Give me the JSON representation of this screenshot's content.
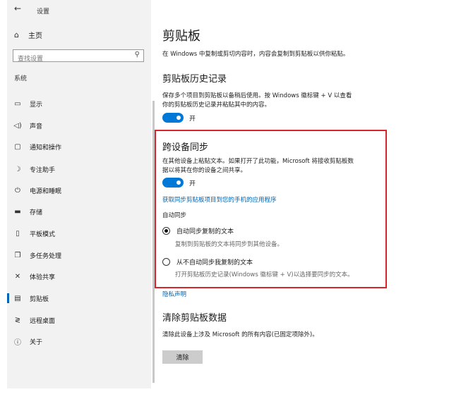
{
  "window": {
    "title": "设置",
    "back_icon": "back-arrow-icon"
  },
  "sidebar": {
    "home_label": "主页",
    "search_placeholder": "查找设置",
    "section_label": "系统",
    "items": [
      {
        "label": "显示",
        "icon": "display-icon"
      },
      {
        "label": "声音",
        "icon": "sound-icon"
      },
      {
        "label": "通知和操作",
        "icon": "notification-icon"
      },
      {
        "label": "专注助手",
        "icon": "focus-assist-icon"
      },
      {
        "label": "电源和睡眠",
        "icon": "power-icon"
      },
      {
        "label": "存储",
        "icon": "storage-icon"
      },
      {
        "label": "平板模式",
        "icon": "tablet-icon"
      },
      {
        "label": "多任务处理",
        "icon": "multitasking-icon"
      },
      {
        "label": "体验共享",
        "icon": "shared-experience-icon"
      },
      {
        "label": "剪贴板",
        "icon": "clipboard-icon",
        "active": true
      },
      {
        "label": "远程桌面",
        "icon": "remote-desktop-icon"
      },
      {
        "label": "关于",
        "icon": "info-icon"
      }
    ]
  },
  "main": {
    "title": "剪贴板",
    "description": "在 Windows 中复制或剪切内容时，内容会复制到剪贴板以供你粘贴。",
    "history": {
      "heading": "剪贴板历史记录",
      "text_line1": "保存多个项目到剪贴板以备稍后使用。按 Windows 徽标键 + V 以查看",
      "text_line2": "你的剪贴板历史记录并粘贴其中的内容。",
      "toggle_label": "开",
      "toggle_on": true
    },
    "sync": {
      "heading": "跨设备同步",
      "text_line1": "在其他设备上粘贴文本。如果打开了此功能，Microsoft 将接收剪贴板数",
      "text_line2": "据以将其在你的设备之间共享。",
      "toggle_label": "开",
      "toggle_on": true,
      "link": "获取同步剪贴板项目到您的手机的应用程序",
      "auto_sync_label": "自动同步",
      "option1_label": "自动同步复制的文本",
      "option1_sub": "复制到剪贴板的文本将同步到其他设备。",
      "option2_label": "从不自动同步我复制的文本",
      "option2_sub": "打开剪贴板历史记录(Windows 徽标键 + V)以选择要同步的文本。",
      "selected_option": 1
    },
    "privacy_link": "隐私声明",
    "clear": {
      "heading": "清除剪贴板数据",
      "text": "清除此设备上涉及 Microsoft 的所有内容(已固定项除外)。",
      "button_label": "清除"
    },
    "highlight_color": "#d6252b",
    "accent_color": "#0078d7"
  }
}
